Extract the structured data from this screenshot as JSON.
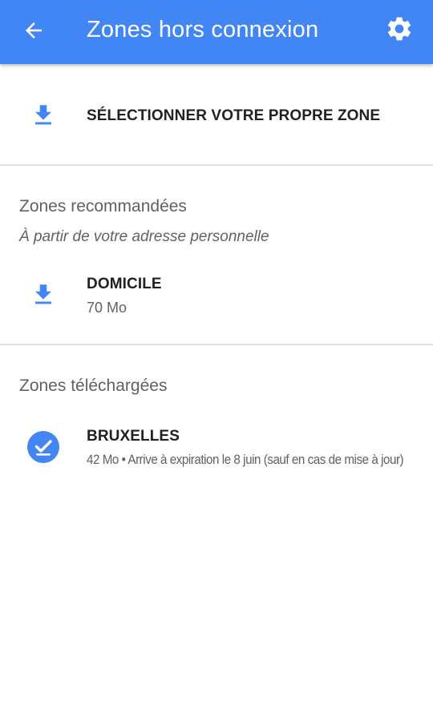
{
  "app_bar": {
    "title": "Zones hors connexion",
    "back_icon": "arrow-back-icon",
    "settings_icon": "gear-icon",
    "color": "#4285f4"
  },
  "select_own_zone": {
    "label": "SÉLECTIONNER VOTRE PROPRE ZONE",
    "icon": "download-icon"
  },
  "recommended": {
    "title": "Zones recommandées",
    "subtitle": "À partir de votre adresse personnelle",
    "items": [
      {
        "name": "DOMICILE",
        "size": "70 Mo",
        "icon": "download-icon"
      }
    ]
  },
  "downloaded": {
    "title": "Zones téléchargées",
    "items": [
      {
        "name": "BRUXELLES",
        "details": "42 Mo • Arrive à expiration le 8 juin (sauf en cas de mise à jour)",
        "icon": "check-circle-icon"
      }
    ]
  },
  "accent_color": "#4285f4"
}
